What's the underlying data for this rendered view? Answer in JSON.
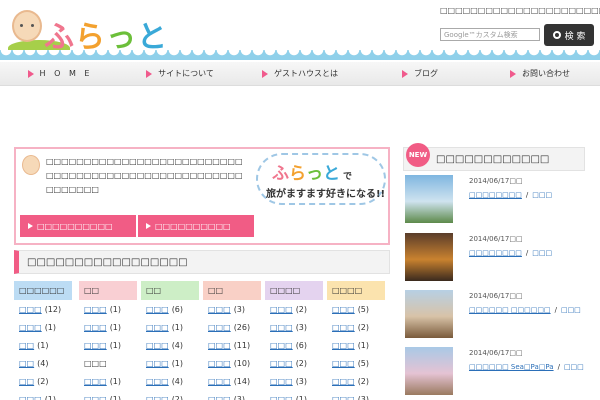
{
  "header": {
    "logo_text": [
      "ふ",
      "ら",
      "っ",
      "と"
    ],
    "tagline": "□□□□□□□□□□□□□□□□□□□□□□□□□□□□□□□□□□□□□",
    "search_placeholder": "Google™カスタム検索",
    "search_button_label": "検 索"
  },
  "nav": {
    "items": [
      {
        "label": "H O M E"
      },
      {
        "label": "サイトについて"
      },
      {
        "label": "ゲストハウスとは"
      },
      {
        "label": "ブログ"
      },
      {
        "label": "お問い合わせ"
      }
    ]
  },
  "intro": {
    "text": "□□□□□□□□□□□□□□□□□□□□□□□□□□□□□□□□□□□□□□□□□□□□□□□□□□□□□□□□□□□",
    "cloud_title_chars": [
      "ふ",
      "ら",
      "っ",
      "と"
    ],
    "cloud_title_de": "で",
    "cloud_sub": "旅がますます好きになる!!",
    "buttons": [
      {
        "label": "□□□□□□□□□□"
      },
      {
        "label": "□□□□□□□□□□"
      }
    ]
  },
  "regions": {
    "title": "□□□□□□□□□□□□□□□□□",
    "columns": [
      {
        "header": "□□□□□□",
        "color": "#bcdcf4",
        "areas": [
          {
            "name": "□□□",
            "count": "(12)"
          },
          {
            "name": "□□□",
            "count": "(1)"
          },
          {
            "name": "□□",
            "count": "(1)"
          },
          {
            "name": "□□",
            "count": "(4)"
          },
          {
            "name": "□□",
            "count": "(2)"
          },
          {
            "name": "□□□",
            "count": "(1)"
          }
        ]
      },
      {
        "header": "□□",
        "color": "#f9cfd3",
        "areas": [
          {
            "name": "□□□",
            "count": "(1)"
          },
          {
            "name": "□□□",
            "count": "(1)"
          },
          {
            "name": "□□□",
            "count": "(1)"
          },
          {
            "name": "□□□",
            "count": "",
            "plain": true
          },
          {
            "name": "□□□",
            "count": "(1)"
          },
          {
            "name": "□□□",
            "count": "(1)"
          }
        ]
      },
      {
        "header": "□□",
        "color": "#cdeec6",
        "areas": [
          {
            "name": "□□□",
            "count": "(6)"
          },
          {
            "name": "□□□",
            "count": "(1)"
          },
          {
            "name": "□□□",
            "count": "(4)"
          },
          {
            "name": "□□□",
            "count": "(1)"
          },
          {
            "name": "□□□",
            "count": "(4)"
          },
          {
            "name": "□□□",
            "count": "(2)"
          }
        ]
      },
      {
        "header": "□□",
        "color": "#f9d0c6",
        "areas": [
          {
            "name": "□□□",
            "count": "(3)"
          },
          {
            "name": "□□□",
            "count": "(26)"
          },
          {
            "name": "□□□",
            "count": "(11)"
          },
          {
            "name": "□□□",
            "count": "(10)"
          },
          {
            "name": "□□□",
            "count": "(14)"
          },
          {
            "name": "□□□",
            "count": "(3)"
          }
        ]
      },
      {
        "header": "□□□□",
        "color": "#e4d3ef",
        "areas": [
          {
            "name": "□□□",
            "count": "(2)"
          },
          {
            "name": "□□□",
            "count": "(3)"
          },
          {
            "name": "□□□",
            "count": "(6)"
          },
          {
            "name": "□□□",
            "count": "(2)"
          },
          {
            "name": "□□□",
            "count": "(3)"
          },
          {
            "name": "□□□",
            "count": "(1)"
          }
        ]
      },
      {
        "header": "□□□□",
        "color": "#fbe3ae",
        "areas": [
          {
            "name": "□□□",
            "count": "(5)"
          },
          {
            "name": "□□□",
            "count": "(2)"
          },
          {
            "name": "□□□",
            "count": "(1)"
          },
          {
            "name": "□□□",
            "count": "(5)"
          },
          {
            "name": "□□□",
            "count": "(2)"
          },
          {
            "name": "□□□",
            "count": "(3)"
          }
        ]
      }
    ]
  },
  "sidebar": {
    "new_badge": "NEW",
    "title": "□□□□□□□□□□□□",
    "posts": [
      {
        "date": "2014/06/17□□",
        "title": "□□□□□□□□",
        "sep": "/",
        "category": "□□□",
        "thumb_colors": [
          "#7fb6e0",
          "#cfe3ef",
          "#5d8a4a"
        ]
      },
      {
        "date": "2014/06/17□□",
        "title": "□□□□□□□□",
        "sep": "/",
        "category": "□□□",
        "thumb_colors": [
          "#5a3d2b",
          "#c9822f",
          "#3a2a1e"
        ]
      },
      {
        "date": "2014/06/17□□",
        "title": "□□□□□□ □□□□□□",
        "sep": "/",
        "category": "□□□",
        "thumb_colors": [
          "#b7d0e4",
          "#d8c3a8",
          "#7a5b3c"
        ]
      },
      {
        "date": "2014/06/17□□",
        "title": "□□□□□□ Sea□Pa□Pa",
        "sep": "/",
        "category": "□□□",
        "thumb_colors": [
          "#a9c9e6",
          "#e5c3d4",
          "#9a7a60"
        ]
      }
    ]
  },
  "colors": {
    "accent": "#f15c85",
    "link": "#2b6fb8"
  }
}
